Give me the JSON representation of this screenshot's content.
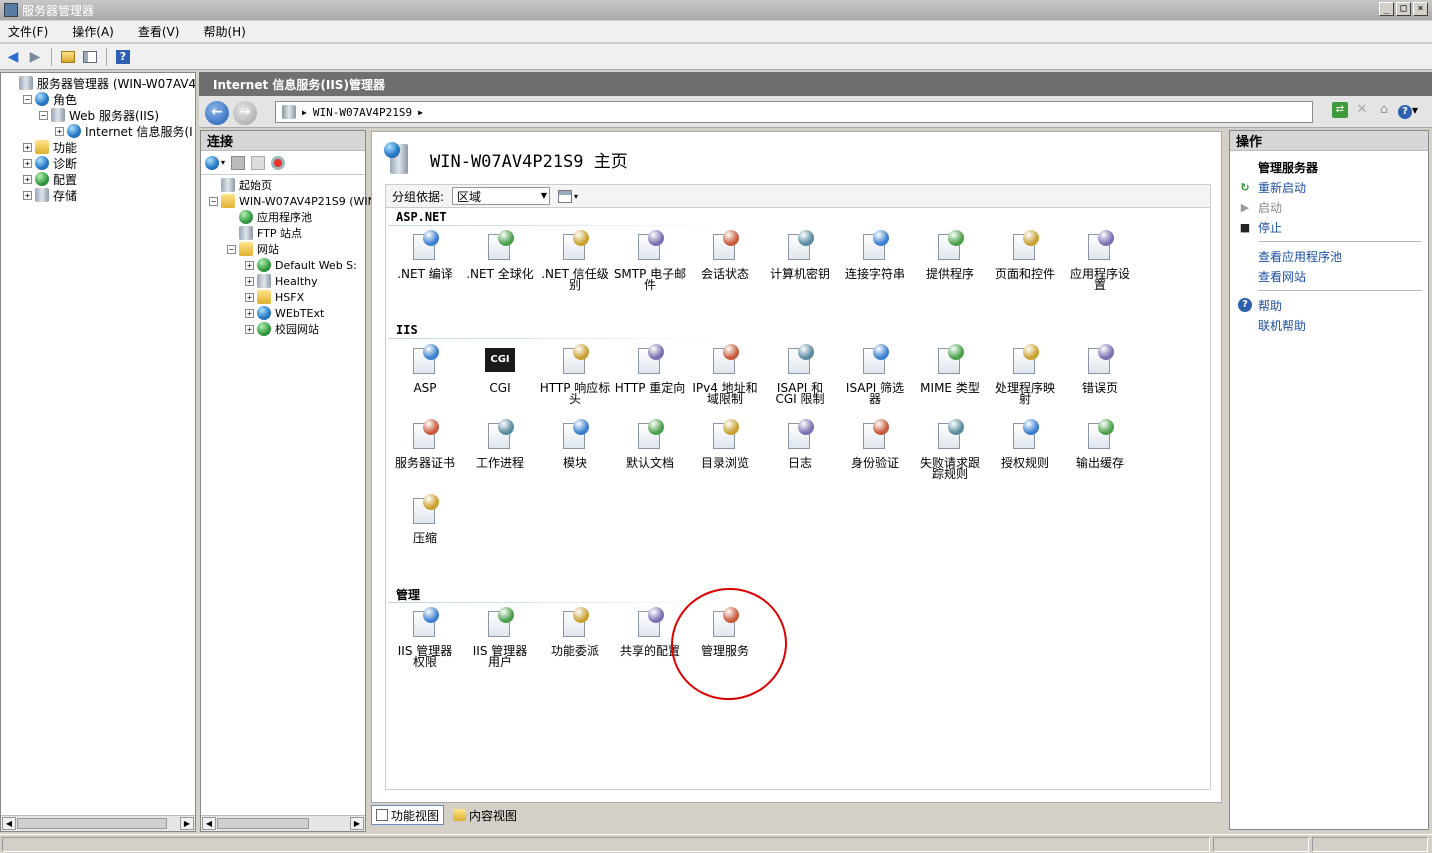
{
  "window": {
    "title": "服务器管理器",
    "controls": [
      "_",
      "□",
      "×"
    ]
  },
  "menu": [
    "文件(F)",
    "操作(A)",
    "查看(V)",
    "帮助(H)"
  ],
  "left_tree": [
    {
      "label": "服务器管理器 (WIN-W07AV4P21S",
      "level": 0,
      "expander": ""
    },
    {
      "label": "角色",
      "level": 1,
      "expander": "−"
    },
    {
      "label": "Web 服务器(IIS)",
      "level": 2,
      "expander": "−"
    },
    {
      "label": "Internet 信息服务(I",
      "level": 3,
      "expander": "+"
    },
    {
      "label": "功能",
      "level": 1,
      "expander": "+"
    },
    {
      "label": "诊断",
      "level": 1,
      "expander": "+"
    },
    {
      "label": "配置",
      "level": 1,
      "expander": "+"
    },
    {
      "label": "存储",
      "level": 1,
      "expander": "+"
    }
  ],
  "iis": {
    "header": "Internet 信息服务(IIS)管理器",
    "address": [
      "WIN-W07AV4P21S9",
      "▶"
    ],
    "connections_title": "连接",
    "connections_tree": [
      {
        "label": "起始页",
        "level": 0,
        "expander": ""
      },
      {
        "label": "WIN-W07AV4P21S9 (WIN",
        "level": 0,
        "expander": "−"
      },
      {
        "label": "应用程序池",
        "level": 1,
        "expander": ""
      },
      {
        "label": "FTP 站点",
        "level": 1,
        "expander": ""
      },
      {
        "label": "网站",
        "level": 1,
        "expander": "−"
      },
      {
        "label": "Default Web S:",
        "level": 2,
        "expander": "+"
      },
      {
        "label": "Healthy",
        "level": 2,
        "expander": "+"
      },
      {
        "label": "HSFX",
        "level": 2,
        "expander": "+"
      },
      {
        "label": "WEbTExt",
        "level": 2,
        "expander": "+"
      },
      {
        "label": "校园网站",
        "level": 2,
        "expander": "+"
      }
    ],
    "page_title": "WIN-W07AV4P21S9 主页",
    "group_by_label": "分组依据:",
    "group_by_value": "区域",
    "sections": {
      "aspnet": "ASP.NET",
      "iis": "IIS",
      "manage": "管理"
    },
    "aspnet_features": [
      {
        "l1": ".NET 编译",
        "l2": "",
        "icon": "compile-icon"
      },
      {
        "l1": ".NET 全球化",
        "l2": "",
        "icon": "globalization-icon"
      },
      {
        "l1": ".NET 信任级",
        "l2": "别",
        "icon": "trust-level-icon"
      },
      {
        "l1": "SMTP 电子邮",
        "l2": "件",
        "icon": "smtp-email-icon"
      },
      {
        "l1": "会话状态",
        "l2": "",
        "icon": "session-state-icon"
      },
      {
        "l1": "计算机密钥",
        "l2": "",
        "icon": "machine-key-icon"
      },
      {
        "l1": "连接字符串",
        "l2": "",
        "icon": "connection-string-icon"
      },
      {
        "l1": "提供程序",
        "l2": "",
        "icon": "providers-icon"
      },
      {
        "l1": "页面和控件",
        "l2": "",
        "icon": "pages-controls-icon"
      },
      {
        "l1": "应用程序设",
        "l2": "置",
        "icon": "app-settings-icon"
      }
    ],
    "iis_features": [
      {
        "l1": "ASP",
        "l2": "",
        "icon": "asp-icon"
      },
      {
        "l1": "CGI",
        "l2": "",
        "icon": "cgi-icon"
      },
      {
        "l1": "HTTP 响应标",
        "l2": "头",
        "icon": "http-headers-icon"
      },
      {
        "l1": "HTTP 重定向",
        "l2": "",
        "icon": "http-redirect-icon"
      },
      {
        "l1": "IPv4 地址和",
        "l2": "域限制",
        "icon": "ipv4-restrictions-icon"
      },
      {
        "l1": "ISAPI 和",
        "l2": "CGI 限制",
        "icon": "isapi-cgi-icon"
      },
      {
        "l1": "ISAPI 筛选",
        "l2": "器",
        "icon": "isapi-filters-icon"
      },
      {
        "l1": "MIME 类型",
        "l2": "",
        "icon": "mime-types-icon"
      },
      {
        "l1": "处理程序映",
        "l2": "射",
        "icon": "handler-mappings-icon"
      },
      {
        "l1": "错误页",
        "l2": "",
        "icon": "error-pages-icon"
      },
      {
        "l1": "服务器证书",
        "l2": "",
        "icon": "server-certificates-icon"
      },
      {
        "l1": "工作进程",
        "l2": "",
        "icon": "worker-processes-icon"
      },
      {
        "l1": "模块",
        "l2": "",
        "icon": "modules-icon"
      },
      {
        "l1": "默认文档",
        "l2": "",
        "icon": "default-document-icon"
      },
      {
        "l1": "目录浏览",
        "l2": "",
        "icon": "directory-browsing-icon"
      },
      {
        "l1": "日志",
        "l2": "",
        "icon": "logging-icon"
      },
      {
        "l1": "身份验证",
        "l2": "",
        "icon": "authentication-icon"
      },
      {
        "l1": "失败请求跟",
        "l2": "踪规则",
        "icon": "failed-request-tracing-icon"
      },
      {
        "l1": "授权规则",
        "l2": "",
        "icon": "authorization-rules-icon"
      },
      {
        "l1": "输出缓存",
        "l2": "",
        "icon": "output-caching-icon"
      },
      {
        "l1": "压缩",
        "l2": "",
        "icon": "compression-icon"
      }
    ],
    "manage_features": [
      {
        "l1": "IIS 管理器",
        "l2": "权限",
        "icon": "iis-manager-permissions-icon"
      },
      {
        "l1": "IIS 管理器",
        "l2": "用户",
        "icon": "iis-manager-users-icon"
      },
      {
        "l1": "功能委派",
        "l2": "",
        "icon": "feature-delegation-icon"
      },
      {
        "l1": "共享的配置",
        "l2": "",
        "icon": "shared-configuration-icon"
      },
      {
        "l1": "管理服务",
        "l2": "",
        "icon": "management-service-icon"
      }
    ],
    "view_tabs": [
      "功能视图",
      "内容视图"
    ],
    "actions_title": "操作",
    "actions": {
      "manage_server": "管理服务器",
      "restart": "重新启动",
      "start": "启动",
      "stop": "停止",
      "view_app_pools": "查看应用程序池",
      "view_sites": "查看网站",
      "help": "帮助",
      "online_help": "联机帮助"
    }
  }
}
